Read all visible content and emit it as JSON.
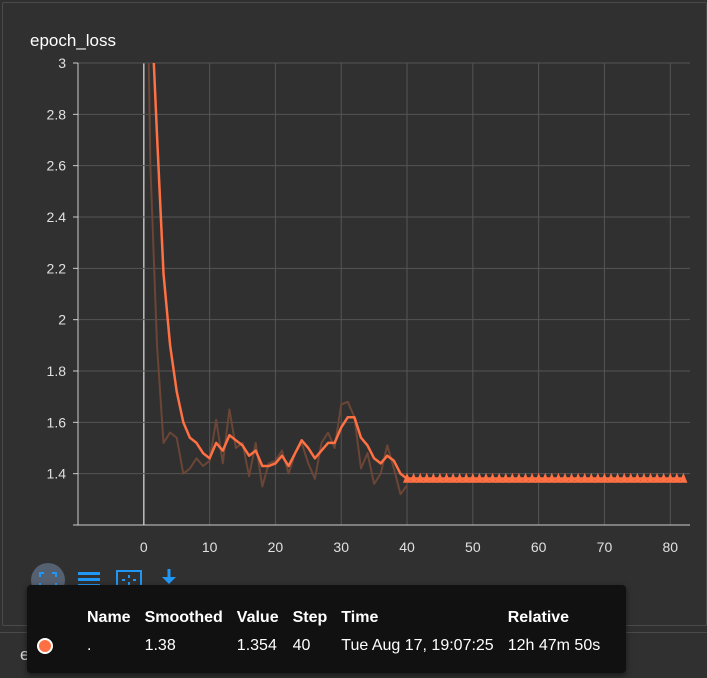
{
  "card": {
    "title": "epoch_loss"
  },
  "next_card": {
    "title": "epoch_mrcnn_bbox_loss"
  },
  "toolbar": {
    "buttons": [
      "fit-domain-icon",
      "toggle-y-log-icon",
      "toggle-data-selection-icon",
      "download-icon"
    ]
  },
  "tooltip": {
    "headers": {
      "name": "Name",
      "smoothed": "Smoothed",
      "value": "Value",
      "step": "Step",
      "time": "Time",
      "relative": "Relative"
    },
    "row": {
      "name": ".",
      "smoothed": "1.38",
      "value": "1.354",
      "step": "40",
      "time": "Tue Aug 17, 19:07:25",
      "relative": "12h 47m 50s"
    },
    "series_color": "#ff7043"
  },
  "colors": {
    "smoothed": "#ff7043",
    "raw": "#6b4536",
    "grid": "#555555",
    "axis": "#cccccc"
  },
  "chart_data": {
    "type": "line",
    "title": "epoch_loss",
    "xlim": [
      -10,
      83
    ],
    "ylim": [
      1.2,
      3.0
    ],
    "x_ticks": [
      0,
      10,
      20,
      30,
      40,
      50,
      60,
      70,
      80
    ],
    "y_ticks": [
      1.4,
      1.6,
      1.8,
      2,
      2.2,
      2.4,
      2.6,
      2.8,
      3
    ],
    "grid": true,
    "series": [
      {
        "role": "raw",
        "x": [
          0,
          1,
          2,
          3,
          4,
          5,
          6,
          7,
          8,
          9,
          10,
          11,
          12,
          13,
          14,
          15,
          16,
          17,
          18,
          19,
          20,
          21,
          22,
          23,
          24,
          25,
          26,
          27,
          28,
          29,
          30,
          31,
          32,
          33,
          34,
          35,
          36,
          37,
          38,
          39,
          40
        ],
        "y": [
          4.2,
          2.6,
          1.9,
          1.52,
          1.56,
          1.54,
          1.4,
          1.42,
          1.46,
          1.43,
          1.45,
          1.61,
          1.44,
          1.65,
          1.5,
          1.52,
          1.39,
          1.52,
          1.35,
          1.44,
          1.45,
          1.49,
          1.4,
          1.48,
          1.52,
          1.44,
          1.38,
          1.52,
          1.56,
          1.5,
          1.67,
          1.68,
          1.62,
          1.42,
          1.48,
          1.36,
          1.4,
          1.51,
          1.42,
          1.32,
          1.354
        ]
      },
      {
        "role": "smoothed",
        "x": [
          0,
          1,
          2,
          3,
          4,
          5,
          6,
          7,
          8,
          9,
          10,
          11,
          12,
          13,
          14,
          15,
          16,
          17,
          18,
          19,
          20,
          21,
          22,
          23,
          24,
          25,
          26,
          27,
          28,
          29,
          30,
          31,
          32,
          33,
          34,
          35,
          36,
          37,
          38,
          39,
          40
        ],
        "y": [
          4.2,
          3.3,
          2.72,
          2.18,
          1.9,
          1.72,
          1.6,
          1.54,
          1.52,
          1.48,
          1.46,
          1.52,
          1.49,
          1.55,
          1.53,
          1.51,
          1.47,
          1.49,
          1.43,
          1.43,
          1.44,
          1.47,
          1.43,
          1.48,
          1.53,
          1.5,
          1.46,
          1.49,
          1.52,
          1.52,
          1.58,
          1.62,
          1.62,
          1.54,
          1.51,
          1.46,
          1.44,
          1.47,
          1.45,
          1.4,
          1.38
        ]
      }
    ],
    "flat_series": {
      "x_start": 40,
      "x_end": 82,
      "y": 1.38,
      "marker": "triangle"
    }
  }
}
